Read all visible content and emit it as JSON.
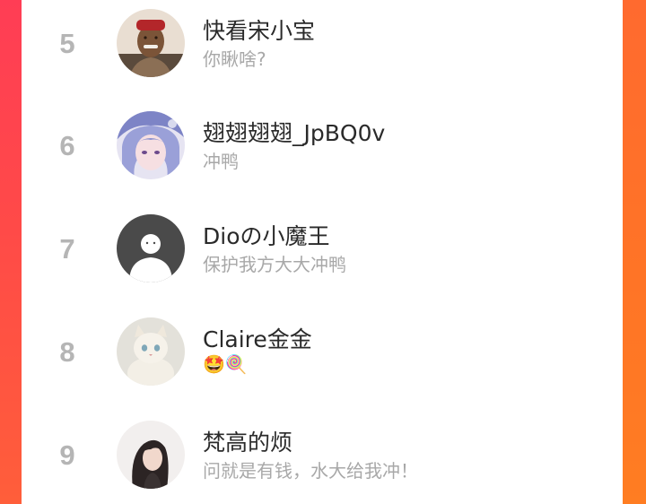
{
  "leaderboard": {
    "rows": [
      {
        "rank": "5",
        "name": "快看宋小宝",
        "subtitle": "你瞅啥?",
        "avatar_icon": "old-man-photo-avatar"
      },
      {
        "rank": "6",
        "name": "翅翅翅翅_JpBQ0v",
        "subtitle": "冲鸭",
        "avatar_icon": "anime-girl-avatar"
      },
      {
        "rank": "7",
        "name": "Dioの小魔王",
        "subtitle": "保护我方大大冲鸭",
        "avatar_icon": "default-user-avatar"
      },
      {
        "rank": "8",
        "name": "Claire金金",
        "subtitle": "🤩🍭",
        "avatar_icon": "white-cat-avatar"
      },
      {
        "rank": "9",
        "name": "梵高的烦",
        "subtitle": "问就是有钱，水大给我冲！",
        "avatar_icon": "woman-photo-avatar"
      }
    ]
  },
  "colors": {
    "frame_left": "#ff4a48",
    "frame_right": "#ff7426",
    "rank_gray": "#b5b5b5",
    "subtitle_gray": "#a8a8a8"
  }
}
